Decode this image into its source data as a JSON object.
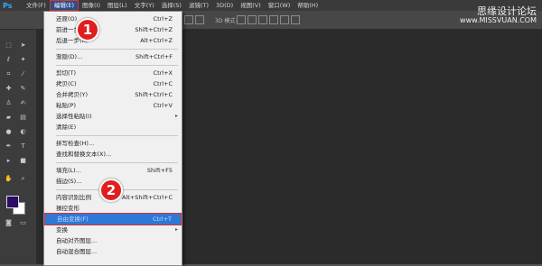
{
  "app": {
    "logo": "Ps"
  },
  "menubar": {
    "items": [
      "文件(F)",
      "编辑(E)",
      "图像(I)",
      "图层(L)",
      "文字(Y)",
      "选择(S)",
      "滤镜(T)",
      "3D(D)",
      "视图(V)",
      "窗口(W)",
      "帮助(H)"
    ],
    "active": "编辑(E)"
  },
  "options": {
    "mode_3d": "3D 模式:"
  },
  "watermark": {
    "text": "思缘设计论坛",
    "url": "www.MISSVUAN.COM"
  },
  "colors": {
    "accent": "#2f78d6",
    "callout": "#e01e1e",
    "foreground_swatch": "#2b0c66"
  },
  "edit_menu": {
    "undo": {
      "label": "还原(O)",
      "shortcut": "Ctrl+Z"
    },
    "step_forward": {
      "label": "前进一步(W)",
      "shortcut": "Shift+Ctrl+Z"
    },
    "step_backward": {
      "label": "后退一步(K)",
      "shortcut": "Alt+Ctrl+Z"
    },
    "fade": {
      "label": "渐隐(D)...",
      "shortcut": "Shift+Ctrl+F"
    },
    "cut": {
      "label": "剪切(T)",
      "shortcut": "Ctrl+X"
    },
    "copy": {
      "label": "拷贝(C)",
      "shortcut": "Ctrl+C"
    },
    "copy_merged": {
      "label": "合并拷贝(Y)",
      "shortcut": "Shift+Ctrl+C"
    },
    "paste": {
      "label": "粘贴(P)",
      "shortcut": "Ctrl+V"
    },
    "paste_special": {
      "label": "选择性粘贴(I)"
    },
    "clear": {
      "label": "清除(E)"
    },
    "spell_check": {
      "label": "拼写检查(H)..."
    },
    "find_replace": {
      "label": "查找和替换文本(X)..."
    },
    "fill": {
      "label": "填充(L)...",
      "shortcut": "Shift+F5"
    },
    "stroke": {
      "label": "描边(S)..."
    },
    "content_aware_scale": {
      "label": "内容识别比例",
      "shortcut": "Alt+Shift+Ctrl+C"
    },
    "puppet_warp": {
      "label": "操控变形"
    },
    "free_transform": {
      "label": "自由变换(F)",
      "shortcut": "Ctrl+T"
    },
    "transform": {
      "label": "变换"
    },
    "auto_align": {
      "label": "自动对齐图层..."
    },
    "auto_blend": {
      "label": "自动混合图层..."
    }
  },
  "callouts": {
    "first": "1",
    "second": "2"
  }
}
